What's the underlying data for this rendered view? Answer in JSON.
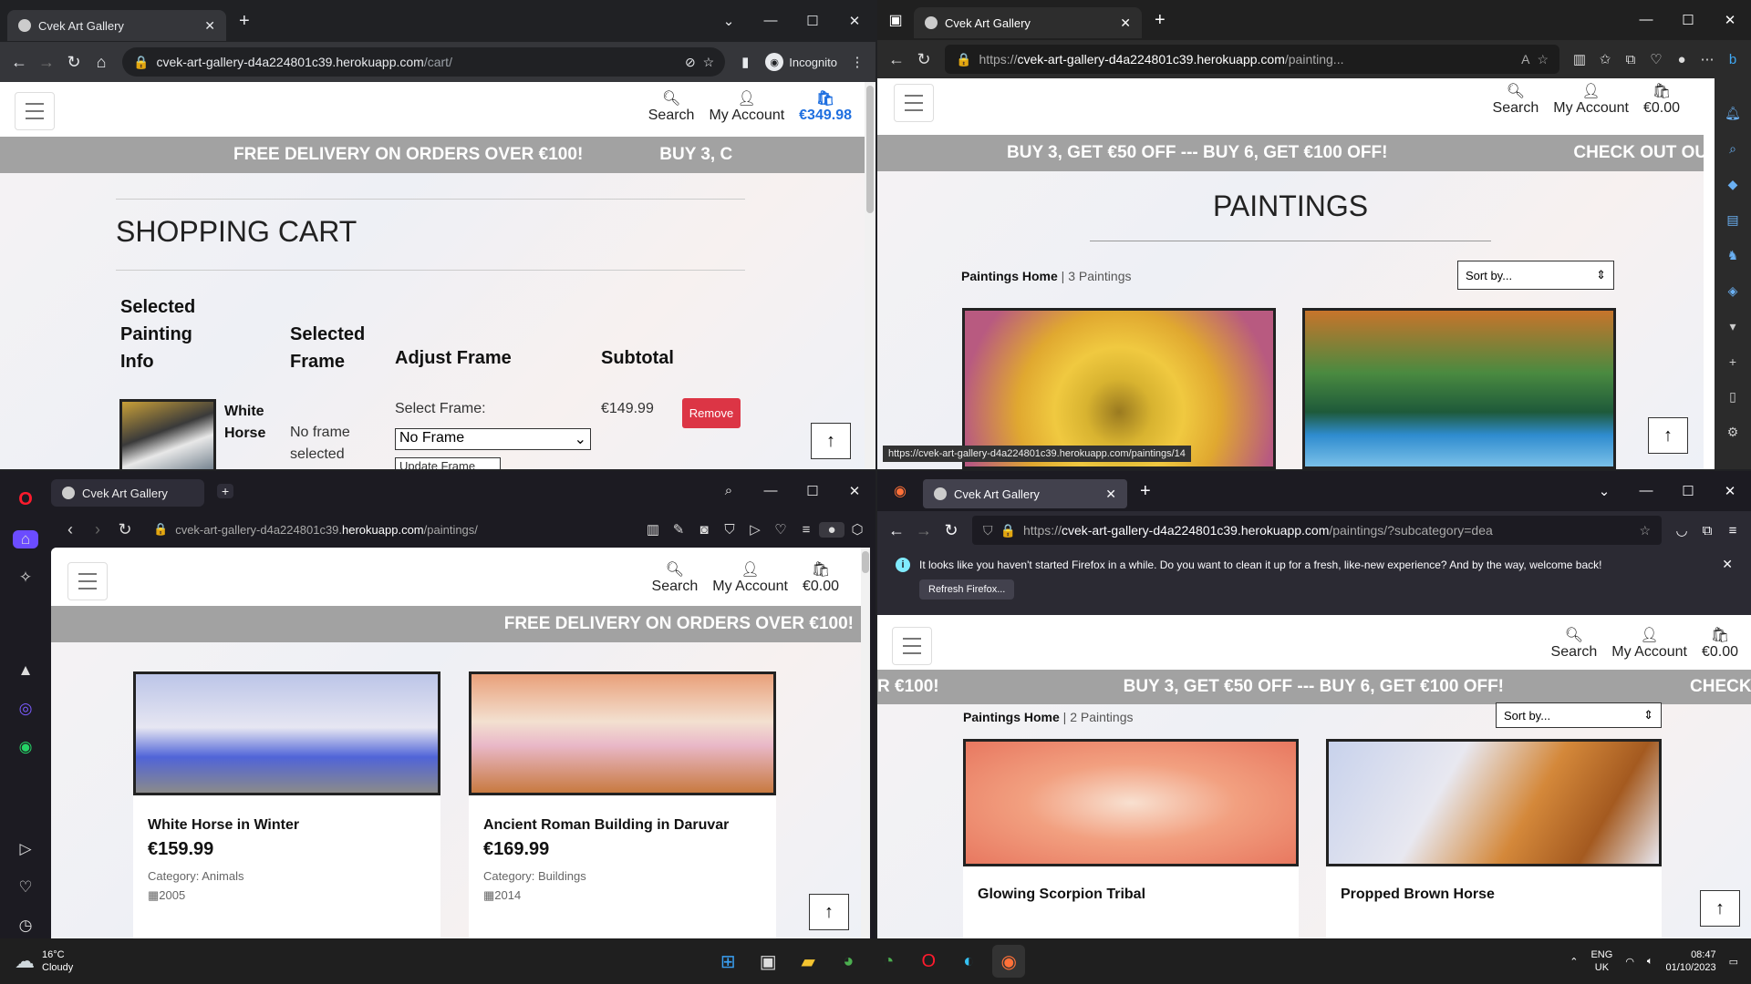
{
  "site": {
    "nav": {
      "search": "Search",
      "account": "My Account"
    },
    "banner_delivery": "FREE DELIVERY ON ORDERS OVER €100!",
    "banner_offer": "BUY 3, GET €50 OFF --- BUY 6, GET €100 OFF!",
    "banner_check": "CHECK OUT OU",
    "banner_partial_left": "R €100!",
    "banner_check_short": "CHECK O",
    "banner_buy_short": "BUY 3, C"
  },
  "w1": {
    "tab_title": "Cvek Art Gallery",
    "url_host": "cvek-art-gallery-d4a224801c39.herokuapp.com",
    "url_path": "/cart/",
    "incognito": "Incognito",
    "bag_total": "€349.98",
    "heading": "SHOPPING CART",
    "col_info": [
      "Selected",
      "Painting",
      "Info"
    ],
    "col_frame": [
      "Selected",
      "Frame"
    ],
    "col_adjust": "Adjust Frame",
    "col_subtotal": "Subtotal",
    "item_name": [
      "White",
      "Horse"
    ],
    "item_frame": [
      "No frame",
      "selected"
    ],
    "select_frame_label": "Select Frame:",
    "select_value": "No Frame",
    "item_subtotal": "€149.99",
    "remove": "Remove",
    "update_partial": "Update Frame"
  },
  "w2": {
    "tab_title": "Cvek Art Gallery",
    "url_prefix": "https://",
    "url_host": "cvek-art-gallery-d4a224801c39.herokuapp.com",
    "url_path": "/painting...",
    "bag_total": "€0.00",
    "heading": "PAINTINGS",
    "crumb": "Paintings Home",
    "count": "3 Paintings",
    "sort_placeholder": "Sort by...",
    "status_url": "https://cvek-art-gallery-d4a224801c39.herokuapp.com/paintings/14"
  },
  "w3": {
    "tab_title": "Cvek Art Gallery",
    "url_host": "cvek-art-gallery-d4a224801c39.",
    "url_host_bold": "herokuapp.com",
    "url_path": "/paintings/",
    "bag_total": "€0.00",
    "cards": [
      {
        "title": "White Horse in Winter",
        "price": "€159.99",
        "category": "Category: Animals",
        "year": "2005"
      },
      {
        "title": "Ancient Roman Building in Daruvar",
        "price": "€169.99",
        "category": "Category: Buildings",
        "year": "2014"
      }
    ]
  },
  "w4": {
    "tab_title": "Cvek Art Gallery",
    "url_prefix": "https://",
    "url_host": "cvek-art-gallery-d4a224801c39.herokuapp.com",
    "url_path": "/paintings/?subcategory=dea",
    "notice": "It looks like you haven't started Firefox in a while. Do you want to clean it up for a fresh, like-new experience? And by the way, welcome back!",
    "refresh_btn": "Refresh Firefox...",
    "bag_total": "€0.00",
    "crumb": "Paintings Home",
    "count": "2 Paintings",
    "sort_placeholder": "Sort by...",
    "cards": [
      {
        "title": "Glowing Scorpion Tribal"
      },
      {
        "title": "Propped Brown Horse"
      }
    ]
  },
  "taskbar": {
    "temp": "16°C",
    "weather": "Cloudy",
    "lang1": "ENG",
    "lang2": "UK",
    "time": "08:47",
    "date": "01/10/2023"
  }
}
